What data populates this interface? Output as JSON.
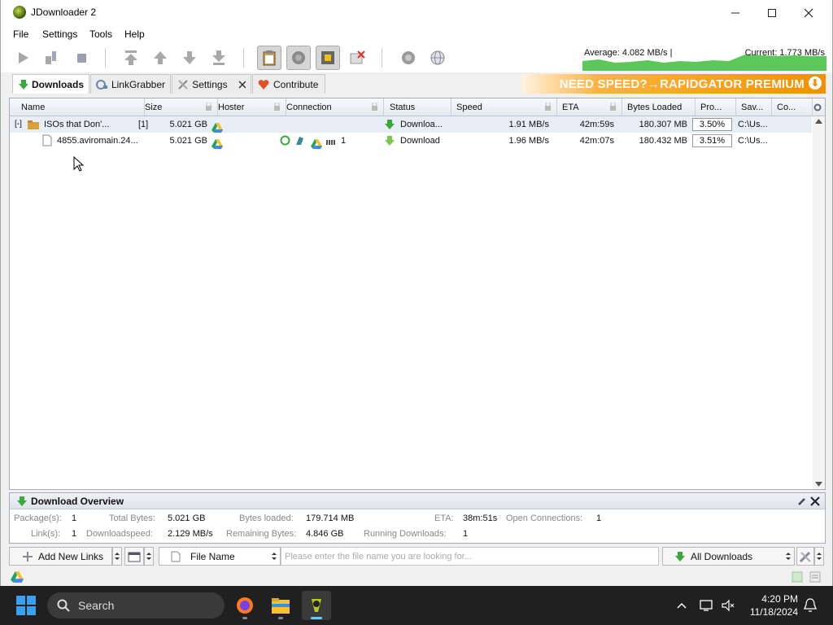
{
  "window": {
    "title": "JDownloader 2"
  },
  "menu": [
    "File",
    "Settings",
    "Tools",
    "Help"
  ],
  "speed": {
    "average": "Average: 4.082 MB/s |",
    "current": "Current: 1.773 MB/s"
  },
  "tabs": [
    {
      "label": "Downloads",
      "icon": "download-arrow-icon",
      "active": true
    },
    {
      "label": "LinkGrabber",
      "icon": "linkgrabber-icon"
    },
    {
      "label": "Settings",
      "icon": "settings-tools-icon",
      "closable": true
    },
    {
      "label": "Contribute",
      "icon": "heart-icon"
    }
  ],
  "promo": {
    "text": "NEED SPEED?→RAPIDGATOR PREMIUM"
  },
  "columns": [
    "Name",
    "Size",
    "Hoster",
    "Connection",
    "Status",
    "Speed",
    "ETA",
    "Bytes Loaded",
    "Pro...",
    "Sav...",
    "Co..."
  ],
  "rows": [
    {
      "type": "package",
      "expand": "[-]",
      "name": "ISOs that Don'...",
      "count": "[1]",
      "size": "5.021 GB",
      "connection": "",
      "status": "Downloa...",
      "speed": "1.91 MB/s",
      "eta": "42m:59s",
      "bytes": "180.307 MB",
      "progress": "3.50%",
      "save": "C:\\Us..."
    },
    {
      "type": "link",
      "name": "4855.aviromain.24...",
      "size": "5.021 GB",
      "connection": "1",
      "status": "Download",
      "speed": "1.96 MB/s",
      "eta": "42m:07s",
      "bytes": "180.432 MB",
      "progress": "3.51%",
      "save": "C:\\Us..."
    }
  ],
  "overview": {
    "title": "Download Overview",
    "packages_label": "Package(s):",
    "packages": "1",
    "total_bytes_label": "Total Bytes:",
    "total_bytes": "5.021 GB",
    "bytes_loaded_label": "Bytes loaded:",
    "bytes_loaded": "179.714 MB",
    "eta_label": "ETA:",
    "eta": "38m:51s",
    "open_conn_label": "Open Connections:",
    "open_conn": "1",
    "links_label": "Link(s):",
    "links": "1",
    "dlspeed_label": "Downloadspeed:",
    "dlspeed": "2.129 MB/s",
    "remaining_label": "Remaining Bytes:",
    "remaining": "4.846 GB",
    "running_label": "Running Downloads:",
    "running": "1"
  },
  "bottom": {
    "add_links": "Add New Links",
    "filter_field": "File Name",
    "search_placeholder": "Please enter the file name you are looking for...",
    "view": "All Downloads"
  },
  "taskbar": {
    "search": "Search",
    "time": "4:20 PM",
    "date": "11/18/2024"
  }
}
